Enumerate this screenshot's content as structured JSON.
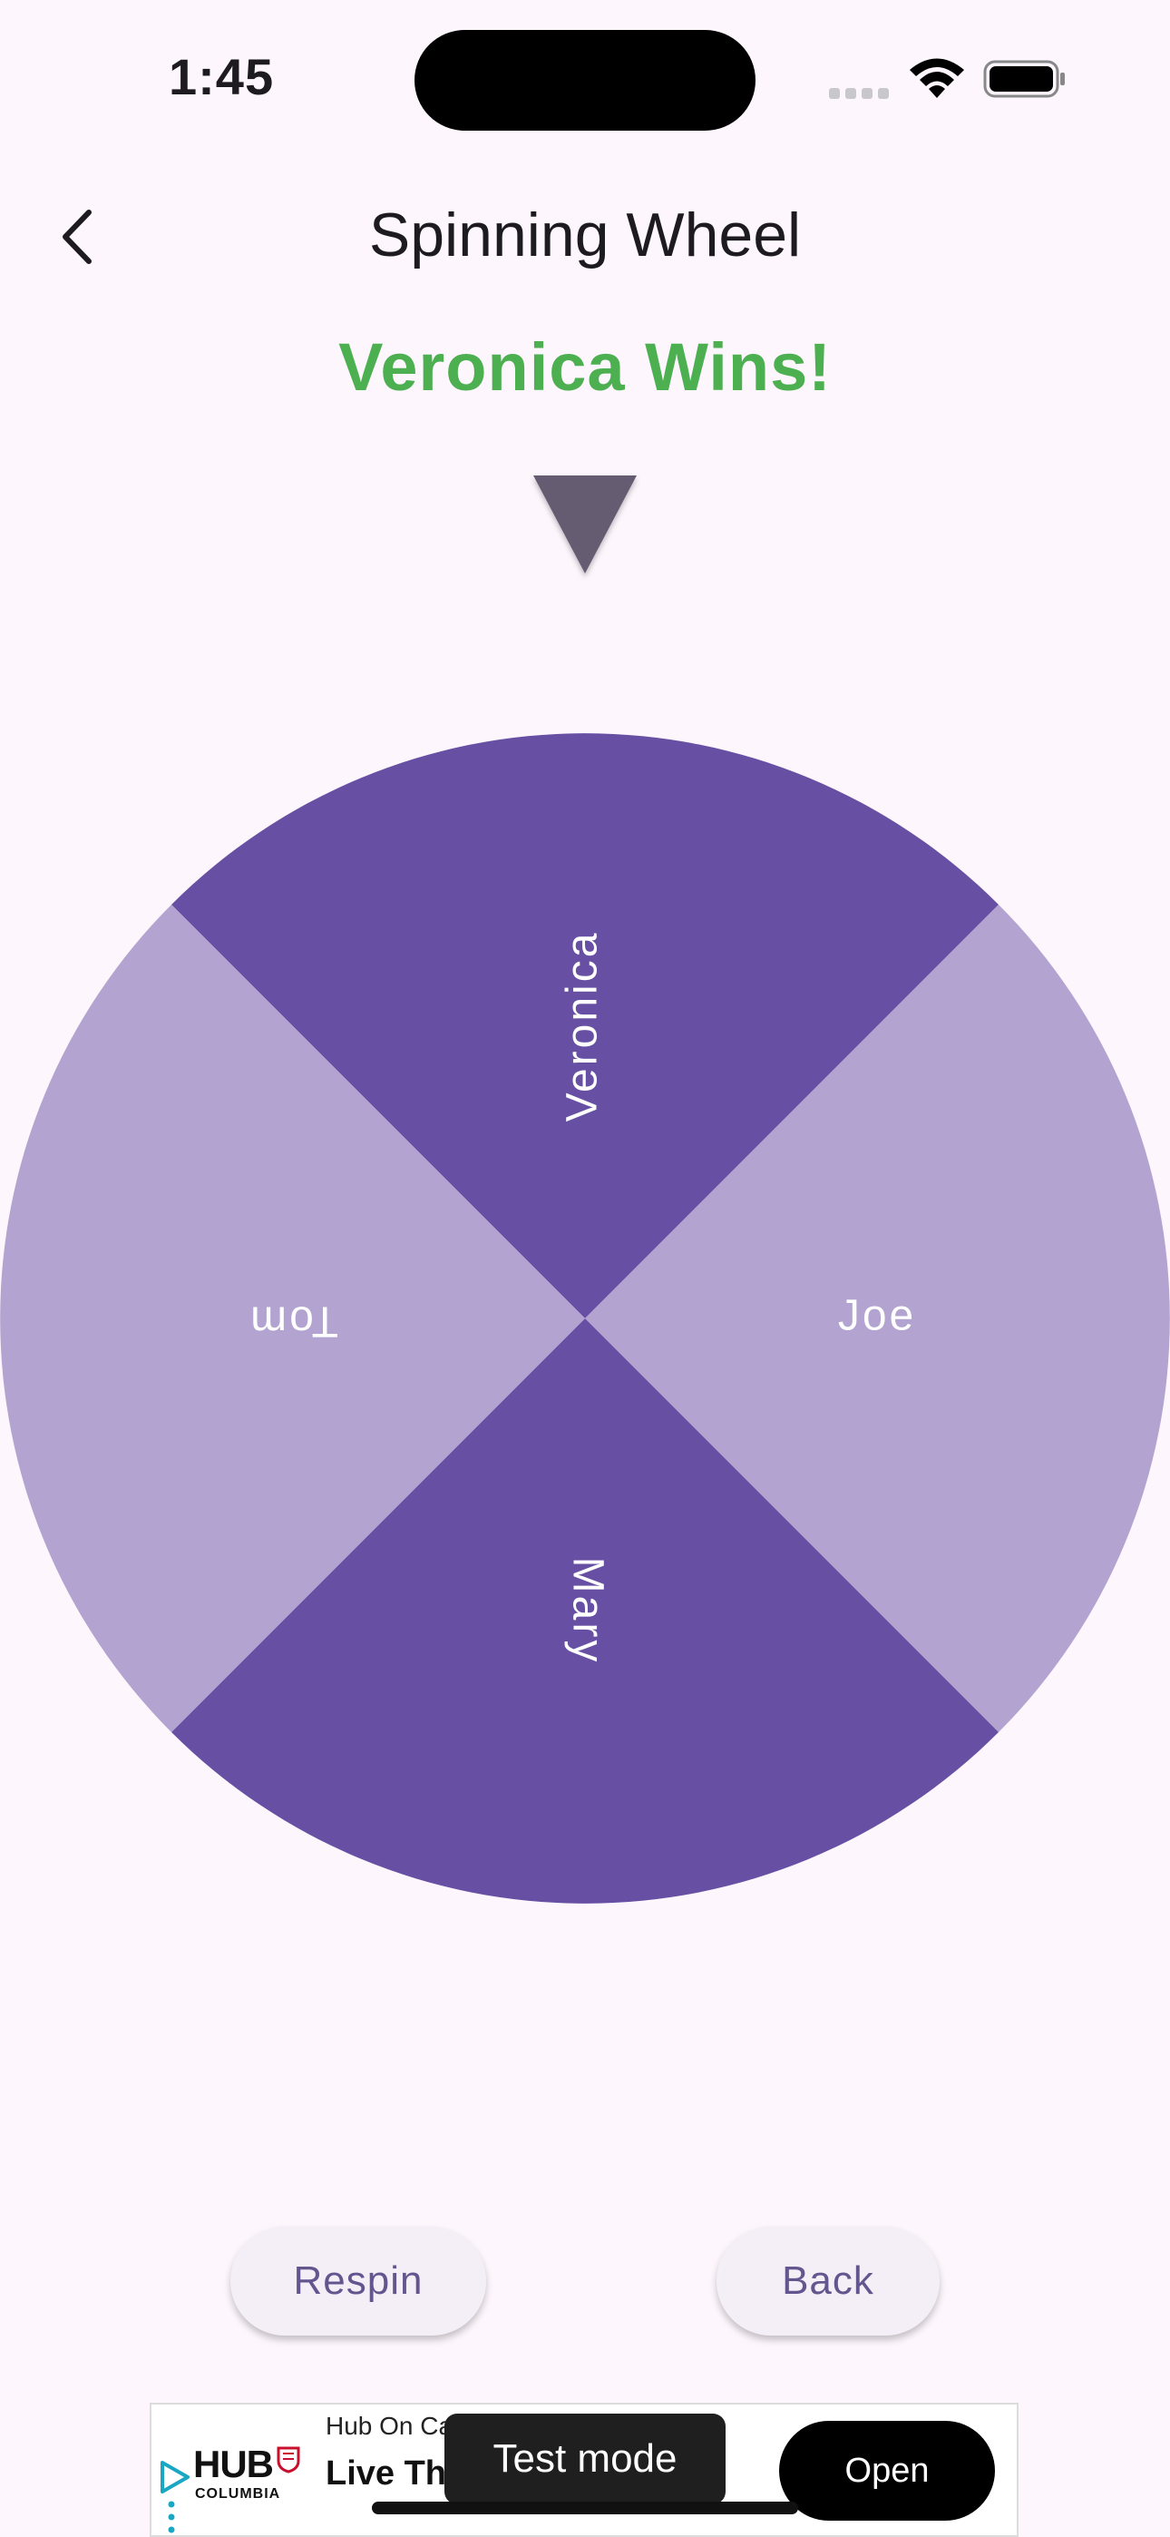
{
  "status_bar": {
    "time": "1:45",
    "icons": [
      "signal-icon",
      "wifi-icon",
      "battery-icon"
    ]
  },
  "nav": {
    "back_icon": "chevron-left-icon",
    "title": "Spinning Wheel"
  },
  "result": {
    "text": "Veronica Wins!",
    "color": "#4caf50"
  },
  "pointer": {
    "icon": "triangle-pointer-icon",
    "color": "#655b72"
  },
  "wheel": {
    "segments": [
      {
        "label": "Veronica",
        "color": "#6750a4"
      },
      {
        "label": "Joe",
        "color": "#b2a3d0"
      },
      {
        "label": "Mary",
        "color": "#6750a4"
      },
      {
        "label": "Tom",
        "color": "#b2a3d0"
      }
    ],
    "label_color": "#ffffff"
  },
  "actions": {
    "respin_label": "Respin",
    "back_label": "Back"
  },
  "ad": {
    "logo": "HUB",
    "logo_sub": "COLUMBIA",
    "sponsor": "Hub On Ca",
    "headline": "Live Th          By Core",
    "open_label": "Open",
    "test_mode_label": "Test mode"
  }
}
